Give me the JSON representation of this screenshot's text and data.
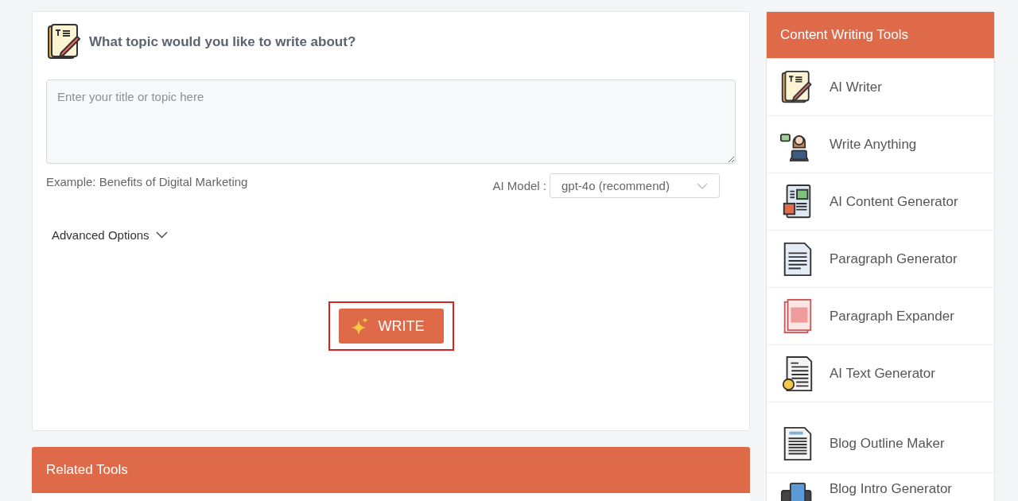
{
  "topic_card": {
    "title": "What topic would you like to write about?",
    "topic_input": {
      "placeholder": "Enter your title or topic here"
    },
    "example": "Example: Benefits of Digital Marketing",
    "model_label": "AI Model :",
    "model_select": {
      "value": "gpt-4o (recommend)"
    },
    "advanced_options": {
      "label": "Advanced Options",
      "expanded": false
    },
    "write_button": {
      "label": "WRITE",
      "highlighted": true
    }
  },
  "related_tools": {
    "title": "Related Tools"
  },
  "sidebar": {
    "title": "Content Writing Tools",
    "items": [
      {
        "label": "AI Writer"
      },
      {
        "label": "Write Anything"
      },
      {
        "label": "AI Content Generator"
      },
      {
        "label": "Paragraph Generator"
      },
      {
        "label": "Paragraph Expander"
      },
      {
        "label": "AI Text Generator"
      },
      {
        "label": "Blog Outline Maker"
      },
      {
        "label": "Blog Intro Generator"
      }
    ]
  }
}
